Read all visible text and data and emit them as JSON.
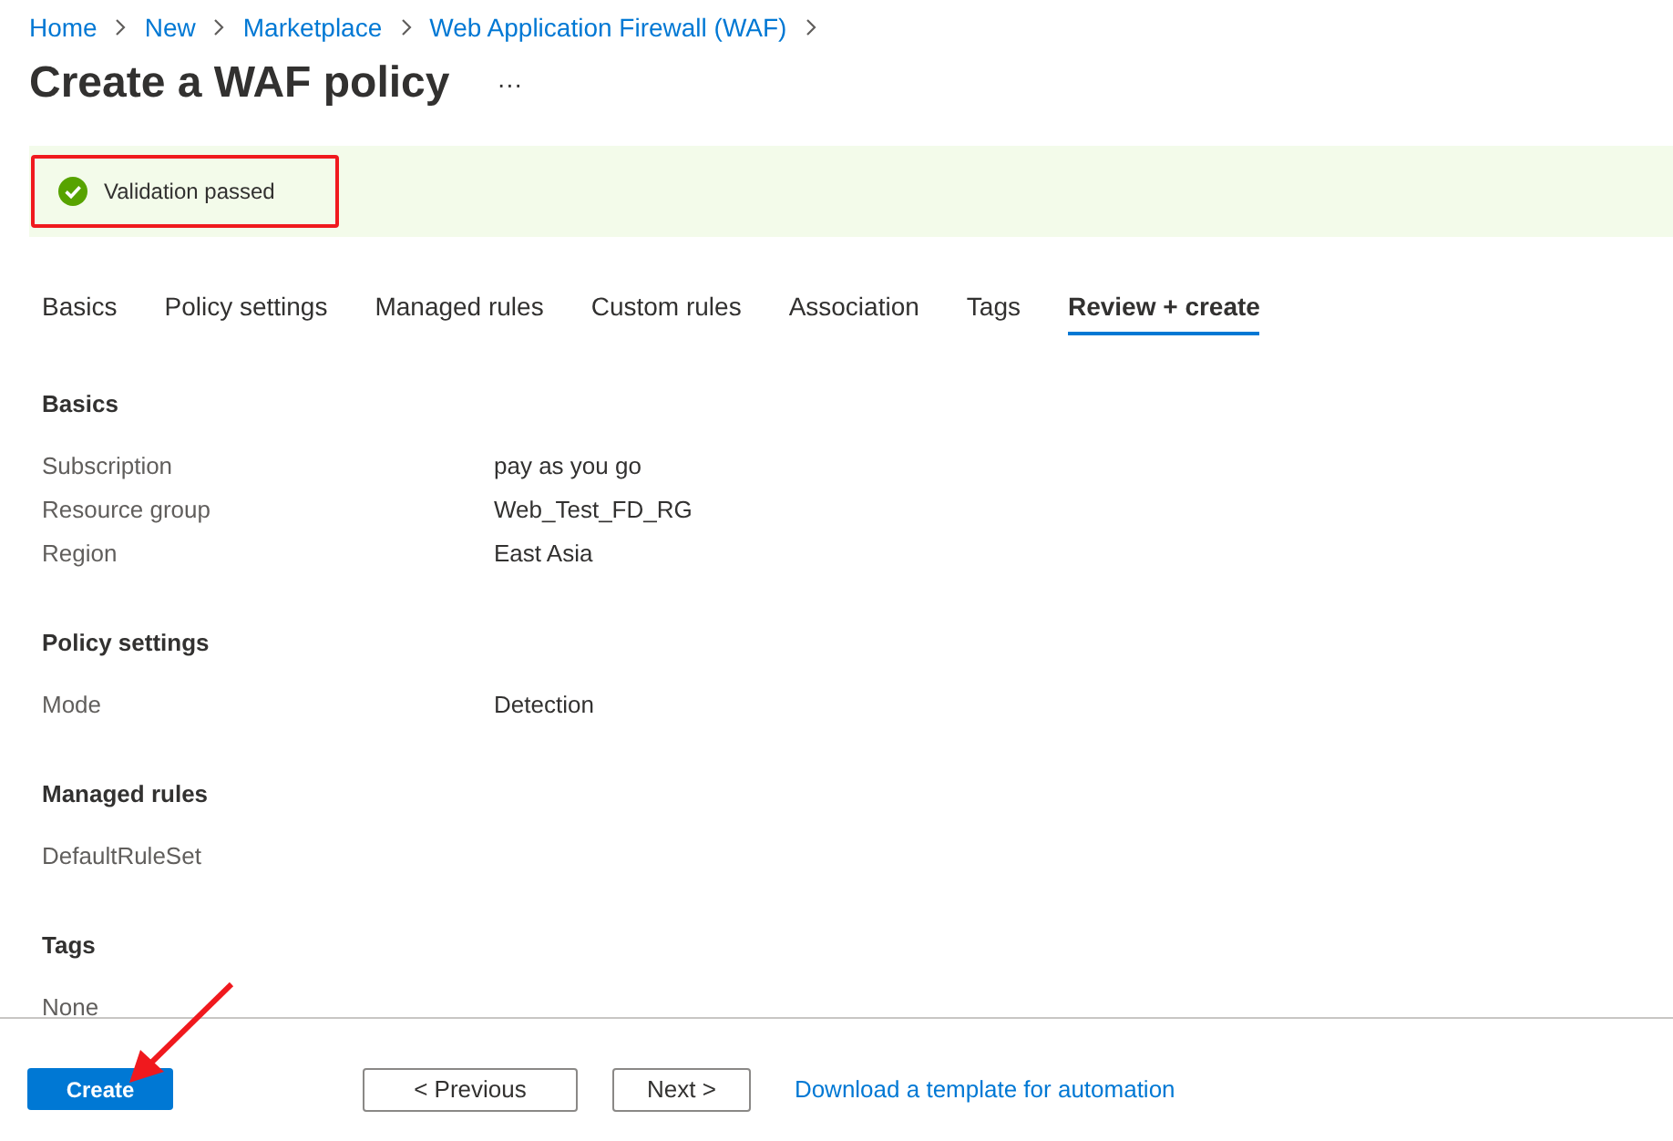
{
  "breadcrumb": [
    "Home",
    "New",
    "Marketplace",
    "Web Application Firewall (WAF)"
  ],
  "title": "Create a WAF policy",
  "more_menu": "···",
  "validation": {
    "message": "Validation passed",
    "passed": true
  },
  "tabs": [
    {
      "label": "Basics",
      "selected": false
    },
    {
      "label": "Policy settings",
      "selected": false
    },
    {
      "label": "Managed rules",
      "selected": false
    },
    {
      "label": "Custom rules",
      "selected": false
    },
    {
      "label": "Association",
      "selected": false
    },
    {
      "label": "Tags",
      "selected": false
    },
    {
      "label": "Review + create",
      "selected": true
    }
  ],
  "sections": [
    {
      "title": "Basics",
      "rows": [
        {
          "label": "Subscription",
          "value": "pay as you go"
        },
        {
          "label": "Resource group",
          "value": "Web_Test_FD_RG"
        },
        {
          "label": "Region",
          "value": "East Asia"
        }
      ]
    },
    {
      "title": "Policy settings",
      "rows": [
        {
          "label": "Mode",
          "value": "Detection"
        }
      ]
    },
    {
      "title": "Managed rules",
      "rows": [
        {
          "label": "DefaultRuleSet"
        }
      ]
    },
    {
      "title": "Tags",
      "rows": [
        {
          "label": "None"
        }
      ]
    }
  ],
  "footer": {
    "create": "Create",
    "previous": "< Previous",
    "next": "Next >",
    "template_link": "Download a template for automation"
  }
}
